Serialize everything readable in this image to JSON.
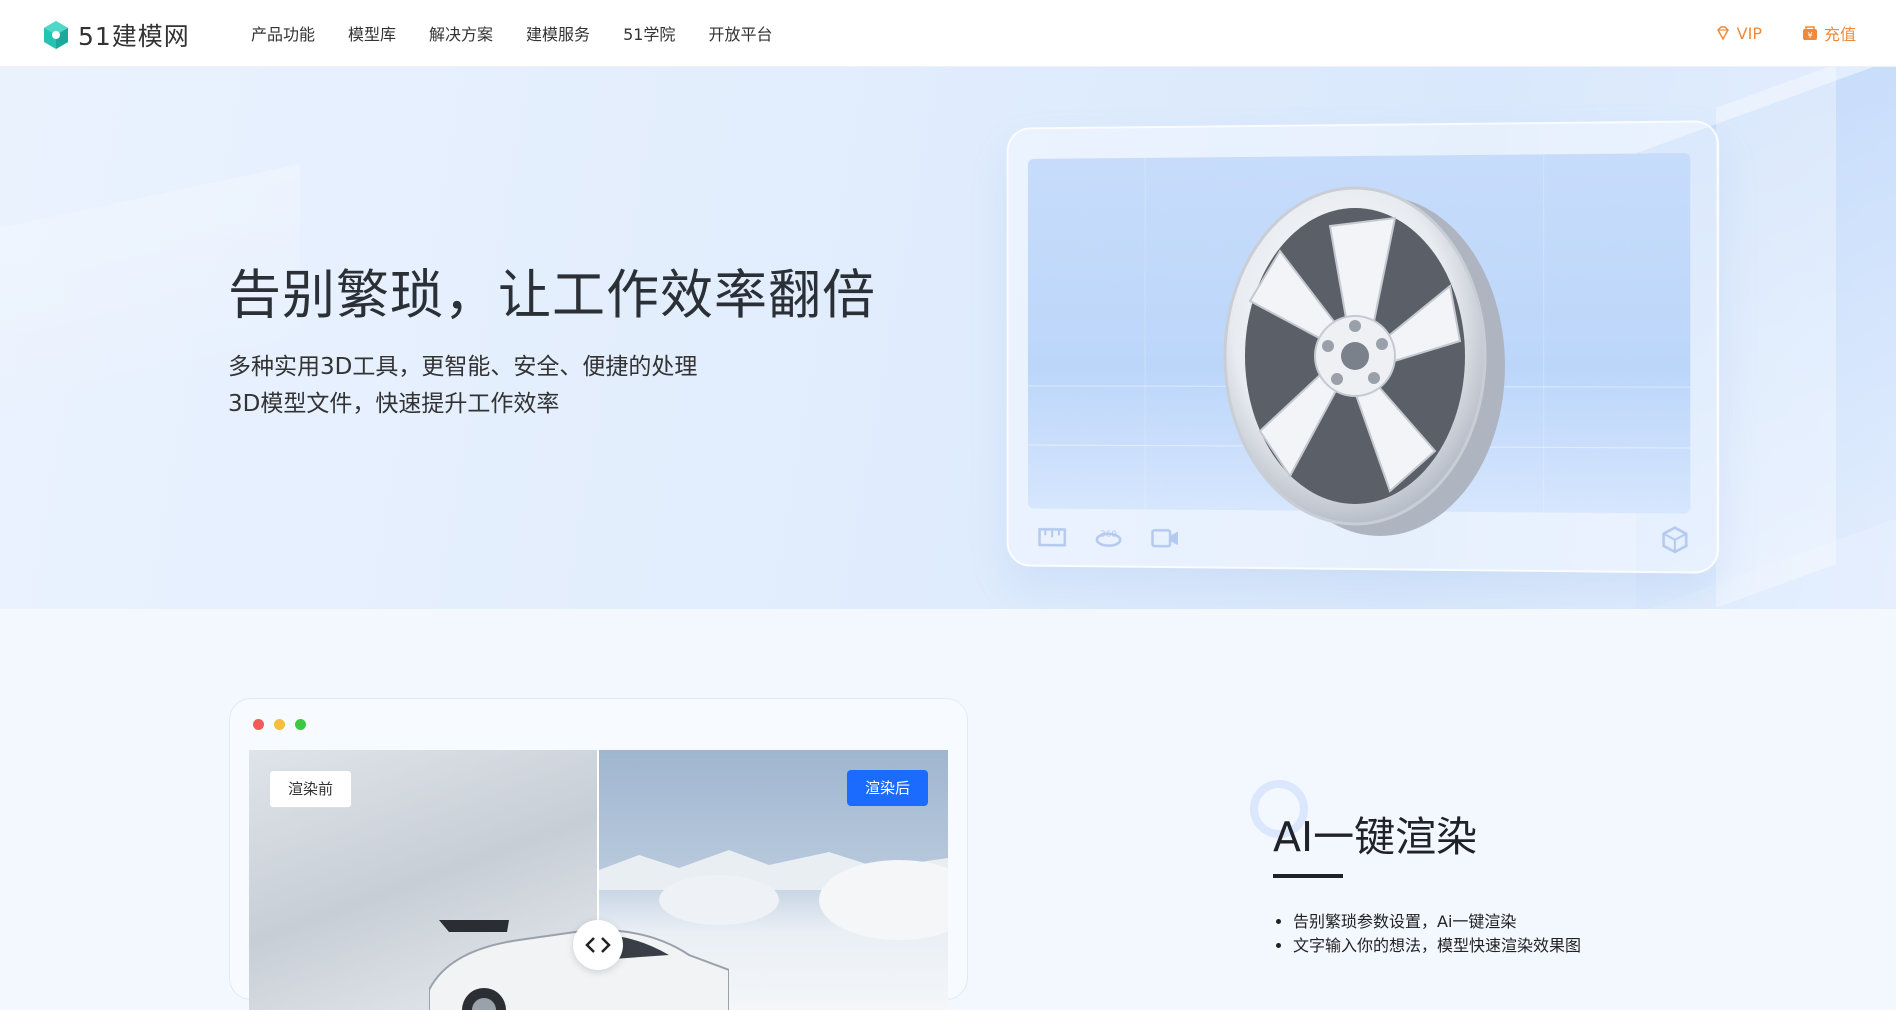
{
  "brand": {
    "name": "51建模网"
  },
  "nav": {
    "items": [
      "产品功能",
      "模型库",
      "解决方案",
      "建模服务",
      "51学院",
      "开放平台"
    ]
  },
  "top_right": {
    "vip": "VIP",
    "recharge": "充值"
  },
  "hero": {
    "title": "告别繁琐，让工作效率翻倍",
    "subtitle_line1": "多种实用3D工具，更智能、安全、便捷的处理",
    "subtitle_line2": "3D模型文件，快速提升工作效率"
  },
  "render_demo": {
    "before_label": "渲染前",
    "after_label": "渲染后"
  },
  "feature": {
    "title": "AI一键渲染",
    "bullets": [
      "告别繁琐参数设置，Ai一键渲染",
      "文字输入你的想法，模型快速渲染效果图"
    ]
  },
  "colors": {
    "accent_orange": "#f08a3a",
    "primary_blue": "#1b6bff",
    "brand_teal": "#25c3b4"
  }
}
